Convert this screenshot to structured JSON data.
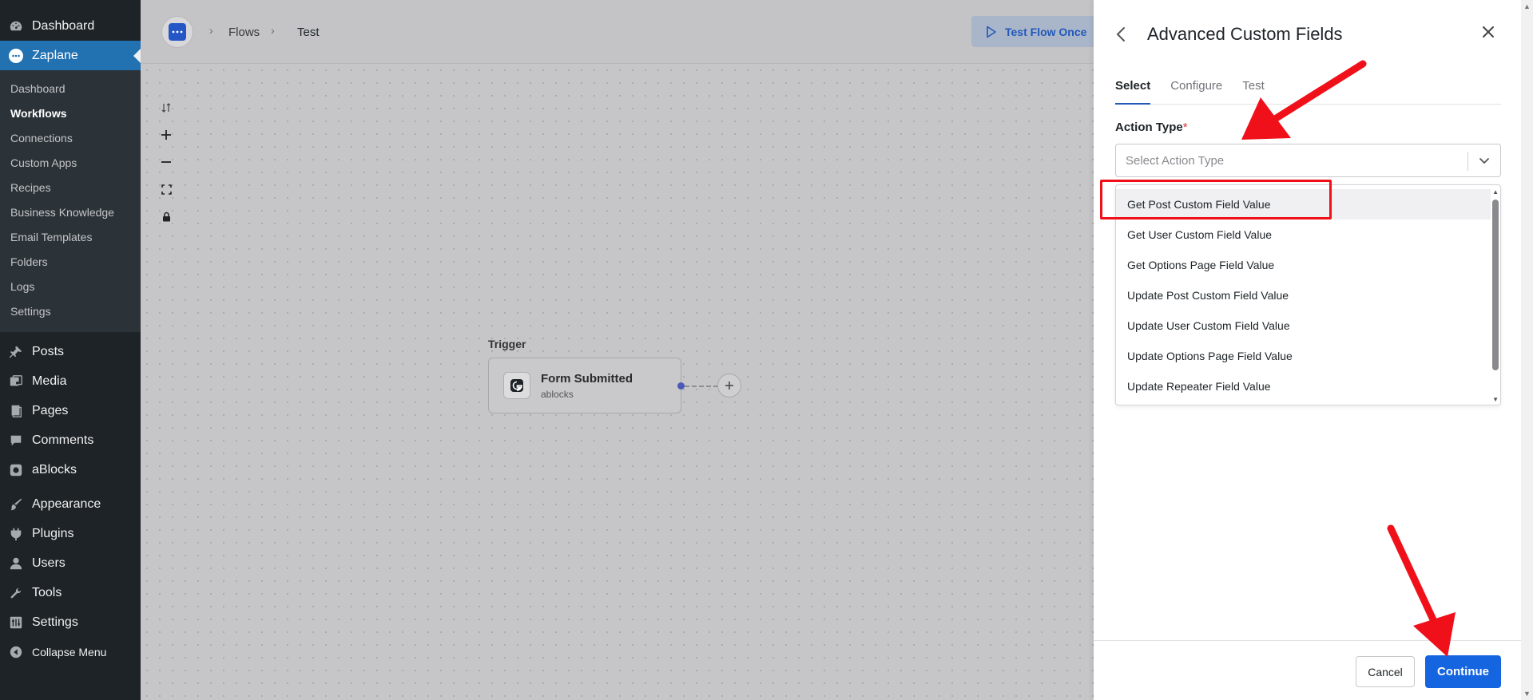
{
  "wp_menu": {
    "dashboard": "Dashboard",
    "zaplane": "Zaplane",
    "zaplane_sub": [
      "Dashboard",
      "Workflows",
      "Connections",
      "Custom Apps",
      "Recipes",
      "Business Knowledge",
      "Email Templates",
      "Folders",
      "Logs",
      "Settings"
    ],
    "posts": "Posts",
    "media": "Media",
    "pages": "Pages",
    "comments": "Comments",
    "ablocks": "aBlocks",
    "appearance": "Appearance",
    "plugins": "Plugins",
    "users": "Users",
    "tools": "Tools",
    "settings": "Settings",
    "collapse": "Collapse Menu"
  },
  "topbar": {
    "crumb_flows": "Flows",
    "crumb_test": "Test",
    "test_flow_label": "Test Flow Once"
  },
  "canvas": {
    "trigger_label": "Trigger",
    "node_title": "Form Submitted",
    "node_subtitle": "ablocks"
  },
  "panel": {
    "title": "Advanced Custom Fields",
    "tabs": [
      "Select",
      "Configure",
      "Test"
    ],
    "action_type_label": "Action Type",
    "required_mark": "*",
    "select_placeholder": "Select Action Type",
    "options": [
      "Get Post Custom Field Value",
      "Get User Custom Field Value",
      "Get Options Page Field Value",
      "Update Post Custom Field Value",
      "Update User Custom Field Value",
      "Update Options Page Field Value",
      "Update Repeater Field Value"
    ],
    "cancel_label": "Cancel",
    "continue_label": "Continue"
  },
  "colors": {
    "wp_sidebar": "#1d2327",
    "wp_active": "#2271b1",
    "primary_button": "#1565e0",
    "annotation_red": "#f0101a"
  }
}
